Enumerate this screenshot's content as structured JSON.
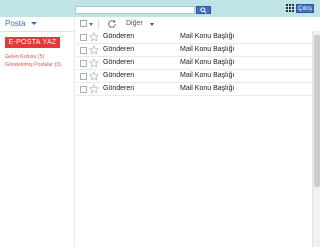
{
  "header": {
    "search": {
      "value": "",
      "placeholder": ""
    },
    "search_icon": "search-icon",
    "apps_icon": "grid-icon",
    "logout_label": "Çıkış"
  },
  "sidebar": {
    "title": "Posta",
    "compose_label": "E-POSTA YAZ",
    "folders": [
      {
        "label": "Gelen Kutusu (5)"
      },
      {
        "label": "Gönderilmiş Postalar (3)"
      }
    ]
  },
  "toolbar": {
    "more_label": "Diğer"
  },
  "mail_list": {
    "rows": [
      {
        "sender": "Gönderen",
        "subject": "Mail Konu Başlığı"
      },
      {
        "sender": "Gönderen",
        "subject": "Mail Konu Başlığı"
      },
      {
        "sender": "Gönderen",
        "subject": "Mail Konu Başlığı"
      },
      {
        "sender": "Gönderen",
        "subject": "Mail Konu Başlığı"
      },
      {
        "sender": "Gönderen",
        "subject": "Mail Konu Başlığı"
      }
    ]
  },
  "colors": {
    "topbar": "#bfe3e7",
    "accent": "#3f6fc0",
    "compose": "#e2393a",
    "folder_text": "#d9534f"
  }
}
